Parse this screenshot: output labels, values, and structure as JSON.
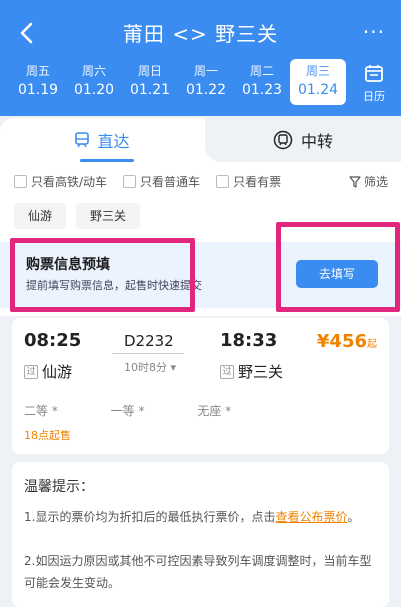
{
  "header": {
    "title": "莆田 <> 野三关",
    "more": "···",
    "calendar_label": "日历"
  },
  "dates": [
    {
      "weekday": "周五",
      "date": "01.19"
    },
    {
      "weekday": "周六",
      "date": "01.20"
    },
    {
      "weekday": "周日",
      "date": "01.21"
    },
    {
      "weekday": "周一",
      "date": "01.22"
    },
    {
      "weekday": "周二",
      "date": "01.23"
    },
    {
      "weekday": "周三",
      "date": "01.24"
    }
  ],
  "tabs": {
    "direct": "直达",
    "transfer": "中转"
  },
  "filters": {
    "high_speed": "只看高铁/动车",
    "normal": "只看普通车",
    "available": "只看有票",
    "screen": "筛选"
  },
  "stations": [
    "仙游",
    "野三关"
  ],
  "prefill": {
    "title": "购票信息预填",
    "subtitle": "提前填写购票信息，起售时快速提交",
    "button": "去填写"
  },
  "train": {
    "depart_time": "08:25",
    "arrive_time": "18:33",
    "number": "D2232",
    "duration": "10时8分",
    "from": "仙游",
    "to": "野三关",
    "pass_badge": "过",
    "price": "¥456",
    "price_suffix": "起",
    "seats": [
      "二等 *",
      "一等 *",
      "无座 *"
    ],
    "sale_time": "18点起售"
  },
  "tips": {
    "title": "温馨提示：",
    "line1": "1.显示的票价均为折扣后的最低执行票价，点击",
    "line1_link": "查看公布票价",
    "line1_end": "。",
    "line2": "2.如因运力原因或其他不可控因素导致列车调度调整时，当前车型可能会发生变动。"
  },
  "colors": {
    "primary": "#3a8cf0",
    "accent": "#f08300",
    "highlight": "#e0277d"
  }
}
